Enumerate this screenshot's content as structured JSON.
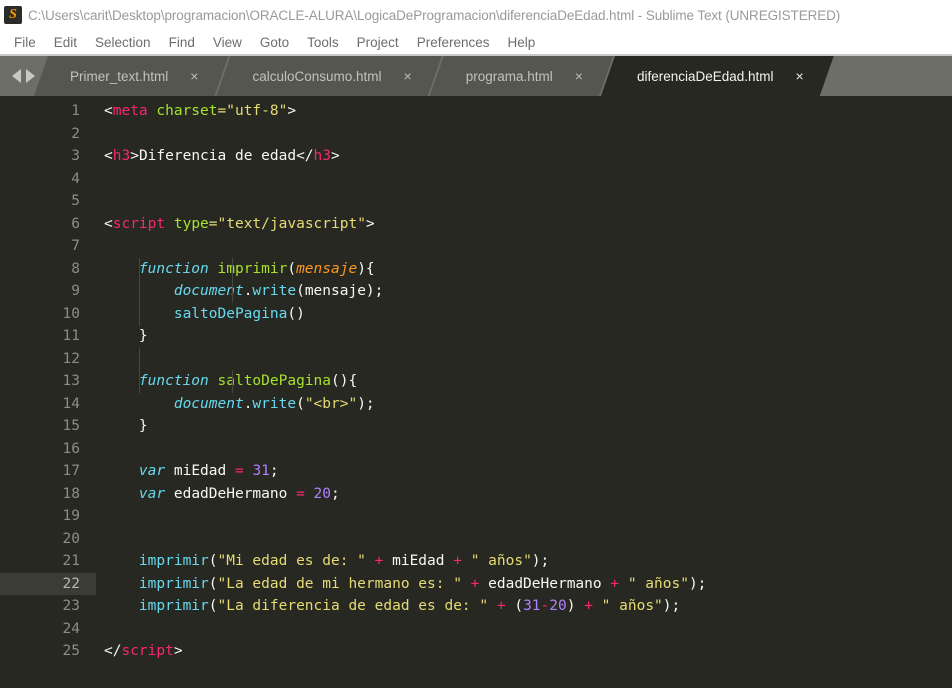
{
  "window": {
    "title": "C:\\Users\\carit\\Desktop\\programacion\\ORACLE-ALURA\\LogicaDeProgramacion\\diferenciaDeEdad.html - Sublime Text (UNREGISTERED)",
    "app_icon_glyph": "S"
  },
  "menu": {
    "items": [
      {
        "label": "File"
      },
      {
        "label": "Edit"
      },
      {
        "label": "Selection"
      },
      {
        "label": "Find"
      },
      {
        "label": "View"
      },
      {
        "label": "Goto"
      },
      {
        "label": "Tools"
      },
      {
        "label": "Project"
      },
      {
        "label": "Preferences"
      },
      {
        "label": "Help"
      }
    ]
  },
  "tab_bar": {
    "prev_arrow": "◀",
    "next_arrow": "▶",
    "close_glyph": "×",
    "tabs": [
      {
        "label": "Primer_text.html",
        "active": false
      },
      {
        "label": "calculoConsumo.html",
        "active": false
      },
      {
        "label": "programa.html",
        "active": false
      },
      {
        "label": "diferenciaDeEdad.html",
        "active": true
      }
    ]
  },
  "editor": {
    "theme": "Monokai",
    "background": "#272822",
    "current_line": 22,
    "colors": {
      "tag": "#f92672",
      "attribute": "#a6e22e",
      "string": "#e6db74",
      "keyword": "#66d9ef",
      "parameter": "#fd971f",
      "number": "#ae81ff",
      "plain": "#f8f8f2",
      "line_number": "#8d8d84"
    },
    "line_numbers": [
      1,
      2,
      3,
      4,
      5,
      6,
      7,
      8,
      9,
      10,
      11,
      12,
      13,
      14,
      15,
      16,
      17,
      18,
      19,
      20,
      21,
      22,
      23,
      24,
      25
    ],
    "lines": [
      {
        "n": 1,
        "tokens": [
          {
            "t": "<",
            "c": "punc"
          },
          {
            "t": "meta",
            "c": "pink"
          },
          {
            "t": " ",
            "c": "plain"
          },
          {
            "t": "charset",
            "c": "green"
          },
          {
            "t": "=",
            "c": "yellow"
          },
          {
            "t": "\"utf-8\"",
            "c": "yellow"
          },
          {
            "t": ">",
            "c": "punc"
          }
        ]
      },
      {
        "n": 2,
        "tokens": []
      },
      {
        "n": 3,
        "tokens": [
          {
            "t": "<",
            "c": "punc"
          },
          {
            "t": "h3",
            "c": "pink"
          },
          {
            "t": ">",
            "c": "punc"
          },
          {
            "t": "Diferencia de edad",
            "c": "plain"
          },
          {
            "t": "</",
            "c": "punc"
          },
          {
            "t": "h3",
            "c": "pink"
          },
          {
            "t": ">",
            "c": "punc"
          }
        ]
      },
      {
        "n": 4,
        "tokens": []
      },
      {
        "n": 5,
        "tokens": []
      },
      {
        "n": 6,
        "tokens": [
          {
            "t": "<",
            "c": "punc"
          },
          {
            "t": "script",
            "c": "pink"
          },
          {
            "t": " ",
            "c": "plain"
          },
          {
            "t": "type",
            "c": "green"
          },
          {
            "t": "=",
            "c": "yellow"
          },
          {
            "t": "\"text/javascript\"",
            "c": "yellow"
          },
          {
            "t": ">",
            "c": "punc"
          }
        ]
      },
      {
        "n": 7,
        "tokens": []
      },
      {
        "n": 8,
        "tokens": [
          {
            "t": "    ",
            "c": "plain"
          },
          {
            "t": "function",
            "c": "cyan-i"
          },
          {
            "t": " ",
            "c": "plain"
          },
          {
            "t": "imprimir",
            "c": "green"
          },
          {
            "t": "(",
            "c": "punc"
          },
          {
            "t": "mensaje",
            "c": "orange"
          },
          {
            "t": "){",
            "c": "punc"
          }
        ]
      },
      {
        "n": 9,
        "tokens": [
          {
            "t": "        ",
            "c": "plain"
          },
          {
            "t": "document",
            "c": "cyan-i"
          },
          {
            "t": ".",
            "c": "punc"
          },
          {
            "t": "write",
            "c": "cyan"
          },
          {
            "t": "(",
            "c": "punc"
          },
          {
            "t": "mensaje",
            "c": "plain"
          },
          {
            "t": ");",
            "c": "punc"
          }
        ]
      },
      {
        "n": 10,
        "tokens": [
          {
            "t": "        ",
            "c": "plain"
          },
          {
            "t": "saltoDePagina",
            "c": "cyan"
          },
          {
            "t": "()",
            "c": "punc"
          }
        ]
      },
      {
        "n": 11,
        "tokens": [
          {
            "t": "    ",
            "c": "plain"
          },
          {
            "t": "}",
            "c": "punc"
          }
        ]
      },
      {
        "n": 12,
        "tokens": []
      },
      {
        "n": 13,
        "tokens": [
          {
            "t": "    ",
            "c": "plain"
          },
          {
            "t": "function",
            "c": "cyan-i"
          },
          {
            "t": " ",
            "c": "plain"
          },
          {
            "t": "saltoDePagina",
            "c": "green"
          },
          {
            "t": "(){",
            "c": "punc"
          }
        ]
      },
      {
        "n": 14,
        "tokens": [
          {
            "t": "        ",
            "c": "plain"
          },
          {
            "t": "document",
            "c": "cyan-i"
          },
          {
            "t": ".",
            "c": "punc"
          },
          {
            "t": "write",
            "c": "cyan"
          },
          {
            "t": "(",
            "c": "punc"
          },
          {
            "t": "\"<br>\"",
            "c": "yellow"
          },
          {
            "t": ");",
            "c": "punc"
          }
        ]
      },
      {
        "n": 15,
        "tokens": [
          {
            "t": "    ",
            "c": "plain"
          },
          {
            "t": "}",
            "c": "punc"
          }
        ]
      },
      {
        "n": 16,
        "tokens": []
      },
      {
        "n": 17,
        "tokens": [
          {
            "t": "    ",
            "c": "plain"
          },
          {
            "t": "var",
            "c": "cyan-i"
          },
          {
            "t": " miEdad ",
            "c": "plain"
          },
          {
            "t": "=",
            "c": "pink"
          },
          {
            "t": " ",
            "c": "plain"
          },
          {
            "t": "31",
            "c": "purple"
          },
          {
            "t": ";",
            "c": "punc"
          }
        ]
      },
      {
        "n": 18,
        "tokens": [
          {
            "t": "    ",
            "c": "plain"
          },
          {
            "t": "var",
            "c": "cyan-i"
          },
          {
            "t": " edadDeHermano ",
            "c": "plain"
          },
          {
            "t": "=",
            "c": "pink"
          },
          {
            "t": " ",
            "c": "plain"
          },
          {
            "t": "20",
            "c": "purple"
          },
          {
            "t": ";",
            "c": "punc"
          }
        ]
      },
      {
        "n": 19,
        "tokens": []
      },
      {
        "n": 20,
        "tokens": []
      },
      {
        "n": 21,
        "tokens": [
          {
            "t": "    ",
            "c": "plain"
          },
          {
            "t": "imprimir",
            "c": "cyan"
          },
          {
            "t": "(",
            "c": "punc"
          },
          {
            "t": "\"Mi edad es de: \"",
            "c": "yellow"
          },
          {
            "t": " ",
            "c": "plain"
          },
          {
            "t": "+",
            "c": "pink"
          },
          {
            "t": " miEdad ",
            "c": "plain"
          },
          {
            "t": "+",
            "c": "pink"
          },
          {
            "t": " ",
            "c": "plain"
          },
          {
            "t": "\" años\"",
            "c": "yellow"
          },
          {
            "t": ");",
            "c": "punc"
          }
        ]
      },
      {
        "n": 22,
        "tokens": [
          {
            "t": "    ",
            "c": "plain"
          },
          {
            "t": "imprimir",
            "c": "cyan"
          },
          {
            "t": "(",
            "c": "punc"
          },
          {
            "t": "\"La edad de mi hermano es: \"",
            "c": "yellow"
          },
          {
            "t": " ",
            "c": "plain"
          },
          {
            "t": "+",
            "c": "pink"
          },
          {
            "t": " edadDeHermano ",
            "c": "plain"
          },
          {
            "t": "+",
            "c": "pink"
          },
          {
            "t": " ",
            "c": "plain"
          },
          {
            "t": "\" años\"",
            "c": "yellow"
          },
          {
            "t": ");",
            "c": "punc"
          }
        ]
      },
      {
        "n": 23,
        "tokens": [
          {
            "t": "    ",
            "c": "plain"
          },
          {
            "t": "imprimir",
            "c": "cyan"
          },
          {
            "t": "(",
            "c": "punc"
          },
          {
            "t": "\"La diferencia de edad es de: \"",
            "c": "yellow"
          },
          {
            "t": " ",
            "c": "plain"
          },
          {
            "t": "+",
            "c": "pink"
          },
          {
            "t": " (",
            "c": "punc"
          },
          {
            "t": "31",
            "c": "purple"
          },
          {
            "t": "-",
            "c": "pink"
          },
          {
            "t": "20",
            "c": "purple"
          },
          {
            "t": ")",
            "c": "punc"
          },
          {
            "t": " ",
            "c": "plain"
          },
          {
            "t": "+",
            "c": "pink"
          },
          {
            "t": " ",
            "c": "plain"
          },
          {
            "t": "\" años\"",
            "c": "yellow"
          },
          {
            "t": ");",
            "c": "punc"
          }
        ]
      },
      {
        "n": 24,
        "tokens": []
      },
      {
        "n": 25,
        "tokens": [
          {
            "t": "</",
            "c": "punc"
          },
          {
            "t": "script",
            "c": "pink"
          },
          {
            "t": ">",
            "c": "punc"
          }
        ]
      }
    ]
  }
}
